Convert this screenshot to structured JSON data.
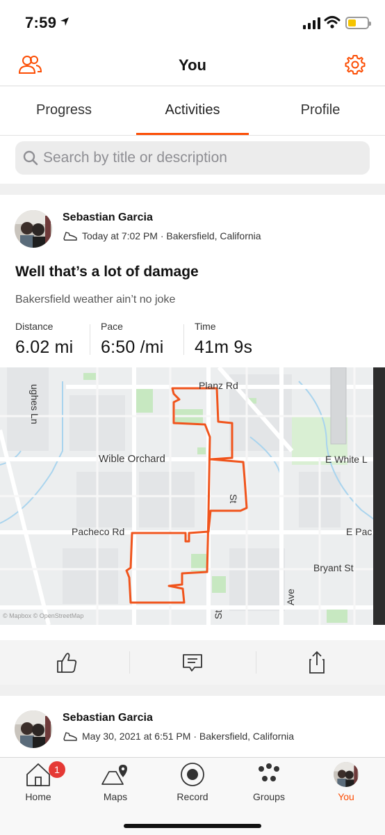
{
  "status_bar": {
    "time": "7:59"
  },
  "header": {
    "title": "You",
    "left_icon": "people-icon",
    "right_icon": "gear-icon",
    "accent_color": "#fc4c02"
  },
  "tabs": [
    {
      "label": "Progress"
    },
    {
      "label": "Activities",
      "selected": true
    },
    {
      "label": "Profile"
    }
  ],
  "search": {
    "placeholder": "Search by title or description"
  },
  "activities": [
    {
      "athlete": "Sebastian Garcia",
      "meta": "Today at 7:02 PM · Bakersfield, California",
      "title": "Well that’s a lot of damage",
      "description": "Bakersfield weather ain’t no joke",
      "stats": [
        {
          "label": "Distance",
          "value": "6.02 mi"
        },
        {
          "label": "Pace",
          "value": "6:50 /mi"
        },
        {
          "label": "Time",
          "value": "41m 9s"
        }
      ],
      "map_labels": {
        "street_1": "Planz Rd",
        "street_2": "Wible Orchard",
        "street_3": "E White L",
        "street_4": "Pacheco Rd",
        "street_5": "E Pac",
        "street_6": "Bryant St",
        "street_7": "ughes Ln",
        "street_8": "Ave",
        "street_9": "St",
        "street_10": "St",
        "attribution": "© Mapbox © OpenStreetMap"
      }
    },
    {
      "athlete": "Sebastian Garcia",
      "meta": "May 30, 2021 at 6:51 PM · Bakersfield, California"
    }
  ],
  "tabbar": [
    {
      "label": "Home",
      "icon": "home-icon",
      "badge": "1"
    },
    {
      "label": "Maps",
      "icon": "map-icon"
    },
    {
      "label": "Record",
      "icon": "record-icon"
    },
    {
      "label": "Groups",
      "icon": "groups-icon"
    },
    {
      "label": "You",
      "icon": "avatar",
      "active": true
    }
  ]
}
